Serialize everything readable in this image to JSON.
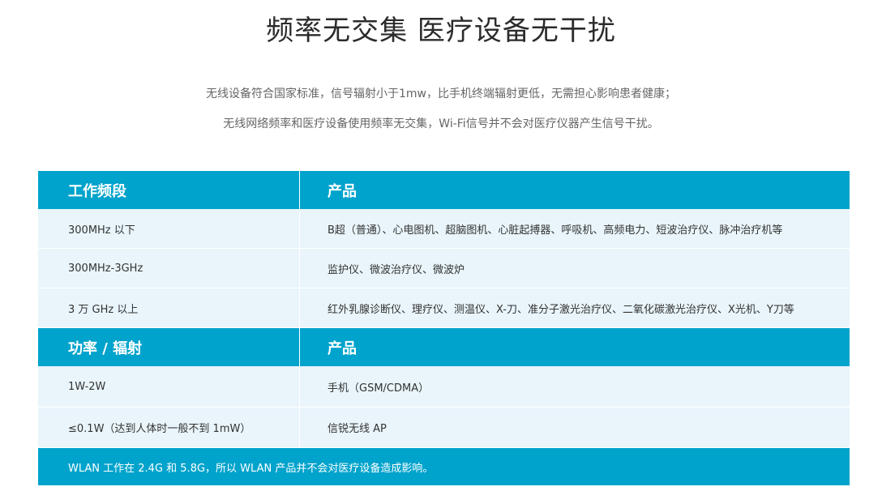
{
  "title": "频率无交集 医疗设备无干扰",
  "description": [
    "无线设备符合国家标准，信号辐射小于1mw，比手机终端辐射更低，无需担心影响患者健康；",
    "无线网络频率和医疗设备使用频率无交集，Wi-Fi信号并不会对医疗仪器产生信号干扰。"
  ],
  "table": {
    "section1": {
      "header": [
        "工作频段",
        "产品"
      ],
      "rows": [
        [
          "300MHz 以下",
          "B超（普通）、心电图机、超脑图机、心脏起搏器、呼吸机、高频电力、短波治疗仪、脉冲治疗机等"
        ],
        [
          "300MHz-3GHz",
          "监护仪、微波治疗仪、微波炉"
        ],
        [
          "3 万 GHz 以上",
          "红外乳腺诊断仪、理疗仪、测温仪、X-刀、准分子激光治疗仪、二氧化碳激光治疗仪、X光机、Y刀等"
        ]
      ]
    },
    "section2": {
      "header": [
        "功率 / 辐射",
        "产品"
      ],
      "rows": [
        [
          "1W-2W",
          "手机（GSM/CDMA）"
        ],
        [
          "≤0.1W（达到人体时一般不到 1mW）",
          "信锐无线  AP"
        ]
      ]
    },
    "footer": "WLAN 工作在 2.4G 和 5.8G，所以 WLAN 产品并不会对医疗设备造成影响。"
  },
  "colors": {
    "accent": "#00a3cc",
    "row_background": "#e9f5fb"
  }
}
